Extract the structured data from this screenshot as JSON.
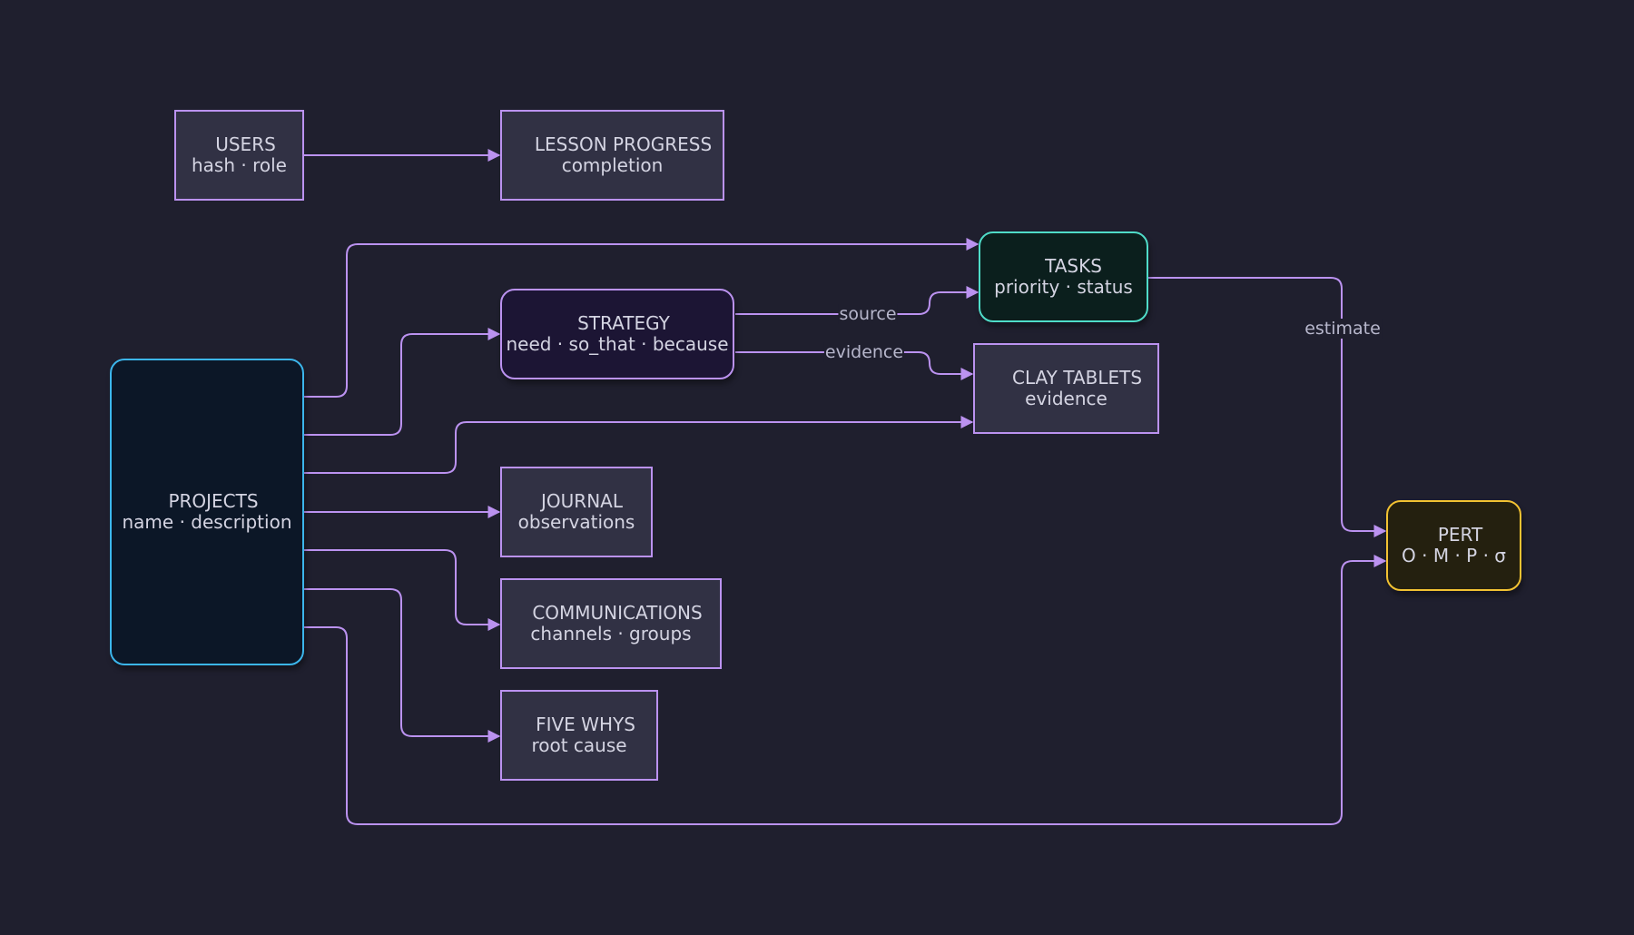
{
  "colors": {
    "background": "#1f1f2e",
    "edge": "#bb92f0",
    "node_fill": "#313144",
    "node_border": "#bb92f0",
    "projects_fill": "#0c1727",
    "projects_border": "#3cb6ec",
    "strategy_fill": "#1c1534",
    "strategy_border": "#bb92f0",
    "tasks_fill": "#0b1f1d",
    "tasks_border": "#4fdcc8",
    "pert_fill": "#24200f",
    "pert_border": "#f2c232"
  },
  "nodes": {
    "users": {
      "title": "USERS",
      "subtitle": "hash · role"
    },
    "lesson_progress": {
      "title": "LESSON PROGRESS",
      "subtitle": "completion"
    },
    "projects": {
      "title": "PROJECTS",
      "subtitle": "name · description"
    },
    "strategy": {
      "title": "STRATEGY",
      "subtitle": "need · so_that · because"
    },
    "tasks": {
      "title": "TASKS",
      "subtitle": "priority · status"
    },
    "clay_tablets": {
      "title": "CLAY TABLETS",
      "subtitle": "evidence"
    },
    "journal": {
      "title": "JOURNAL",
      "subtitle": "observations"
    },
    "communications": {
      "title": "COMMUNICATIONS",
      "subtitle": "channels · groups"
    },
    "five_whys": {
      "title": "FIVE WHYS",
      "subtitle": "root cause"
    },
    "pert": {
      "title": "PERT",
      "subtitle": "O · M · P · σ"
    }
  },
  "edges": [
    {
      "from": "users",
      "to": "lesson_progress",
      "label": ""
    },
    {
      "from": "projects",
      "to": "tasks",
      "label": ""
    },
    {
      "from": "projects",
      "to": "strategy",
      "label": ""
    },
    {
      "from": "projects",
      "to": "clay_tablets",
      "label": ""
    },
    {
      "from": "projects",
      "to": "journal",
      "label": ""
    },
    {
      "from": "projects",
      "to": "communications",
      "label": ""
    },
    {
      "from": "projects",
      "to": "five_whys",
      "label": ""
    },
    {
      "from": "projects",
      "to": "pert",
      "label": ""
    },
    {
      "from": "strategy",
      "to": "tasks",
      "label": "source"
    },
    {
      "from": "strategy",
      "to": "clay_tablets",
      "label": "evidence"
    },
    {
      "from": "tasks",
      "to": "pert",
      "label": "estimate"
    }
  ]
}
